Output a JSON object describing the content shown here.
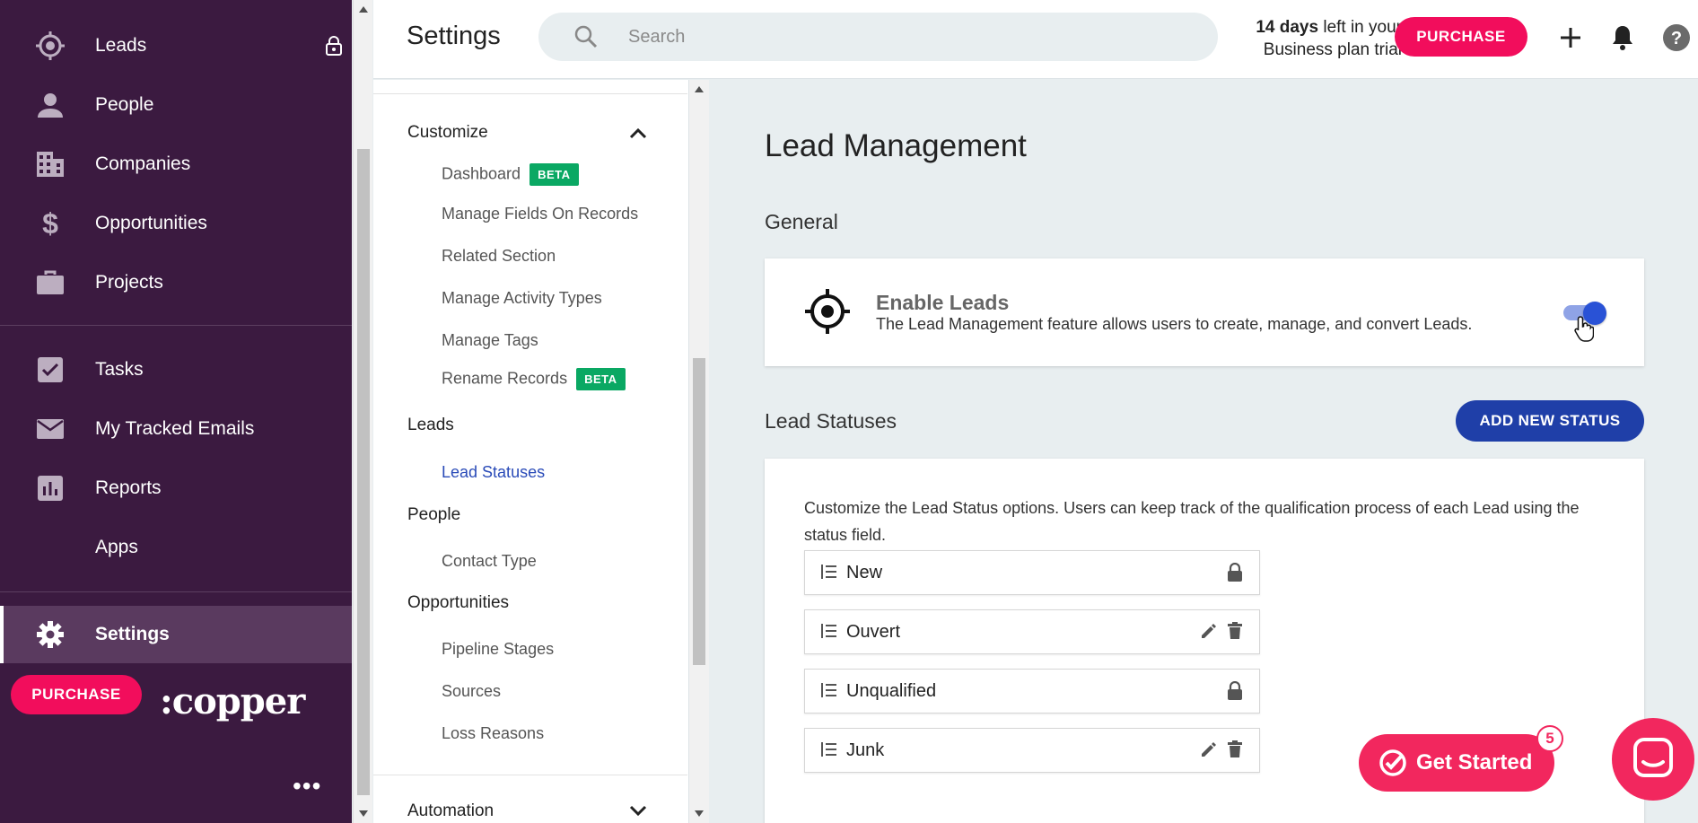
{
  "nav": {
    "items": [
      {
        "label": "Leads",
        "icon": "crosshair-icon"
      },
      {
        "label": "People",
        "icon": "person-icon"
      },
      {
        "label": "Companies",
        "icon": "building-icon"
      },
      {
        "label": "Opportunities",
        "icon": "dollar-icon"
      },
      {
        "label": "Projects",
        "icon": "briefcase-icon"
      },
      {
        "label": "Tasks",
        "icon": "checkbox-icon"
      },
      {
        "label": "My Tracked Emails",
        "icon": "envelope-icon"
      },
      {
        "label": "Reports",
        "icon": "bar-chart-icon"
      },
      {
        "label": "Apps",
        "icon": ""
      },
      {
        "label": "Settings",
        "icon": "gear-icon"
      }
    ],
    "purchase_label": "PURCHASE",
    "logo": ":copper",
    "more": "•••"
  },
  "header": {
    "title": "Settings",
    "search_placeholder": "Search",
    "trial_days": "14 days",
    "trial_rest_1": " left in your",
    "trial_rest_2": "Business plan trial",
    "purchase_label": "PURCHASE"
  },
  "subnav": {
    "customize": "Customize",
    "customize_items": [
      "Dashboard",
      "Manage Fields On Records",
      "Related Section",
      "Manage Activity Types",
      "Manage Tags",
      "Rename Records"
    ],
    "beta": "BETA",
    "leads": "Leads",
    "lead_statuses": "Lead Statuses",
    "people": "People",
    "contact_type": "Contact Type",
    "opportunities": "Opportunities",
    "opp_items": [
      "Pipeline Stages",
      "Sources",
      "Loss Reasons"
    ],
    "automation": "Automation"
  },
  "main": {
    "title": "Lead Management",
    "general": "General",
    "enable_title": "Enable Leads",
    "enable_desc": "The Lead Management feature allows users to create, manage, and convert Leads.",
    "enable_on": true,
    "statuses_title": "Lead Statuses",
    "add_status": "ADD NEW STATUS",
    "status_desc": "Customize the Lead Status options. Users can keep track of the qualification process of each Lead using the status field.",
    "statuses": [
      {
        "name": "New",
        "locked": true
      },
      {
        "name": "Ouvert",
        "locked": false
      },
      {
        "name": "Unqualified",
        "locked": true
      },
      {
        "name": "Junk",
        "locked": false
      }
    ]
  },
  "floating": {
    "get_started": "Get Started",
    "badge": "5"
  },
  "colors": {
    "nav_bg": "#3b1a40",
    "accent_pink": "#f20d5c",
    "primary_blue": "#1f3fa8",
    "beta_green": "#0aa863"
  }
}
